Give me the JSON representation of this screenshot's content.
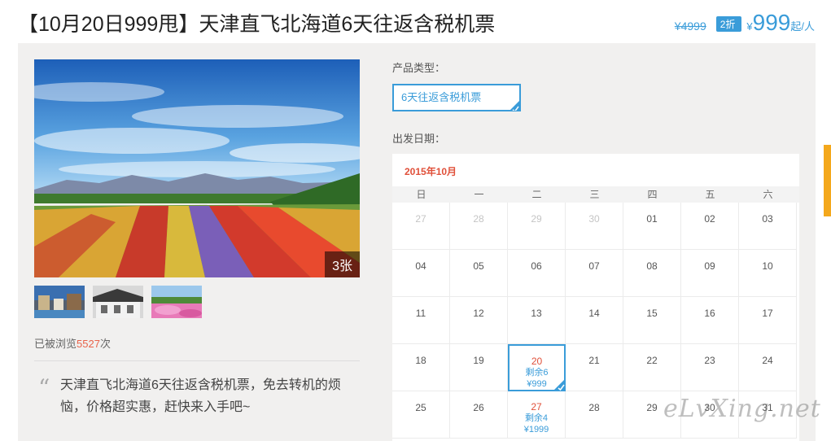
{
  "product": {
    "title": "【10月20日999甩】天津直飞北海道6天往返含税机票"
  },
  "pricing": {
    "original": "¥4999",
    "discount": "2折",
    "currency": "¥",
    "price": "999",
    "per_person": "起/人"
  },
  "gallery": {
    "photo_count": "3张"
  },
  "stats": {
    "views_prefix": "已被浏览",
    "views_count": "5527",
    "views_suffix": "次"
  },
  "intro": {
    "text": "天津直飞北海道6天往返含税机票，免去转机的烦恼，价格超实惠，赶快来入手吧~"
  },
  "options": {
    "product_type_label": "产品类型：",
    "product_type_value": "6天往返含税机票",
    "departure_label": "出发日期："
  },
  "calendar": {
    "month": "2015年10月",
    "weekdays": [
      "日",
      "一",
      "二",
      "三",
      "四",
      "五",
      "六"
    ],
    "weeks": [
      [
        {
          "d": "27",
          "o": true
        },
        {
          "d": "28",
          "o": true
        },
        {
          "d": "29",
          "o": true
        },
        {
          "d": "30",
          "o": true
        },
        {
          "d": "01"
        },
        {
          "d": "02"
        },
        {
          "d": "03"
        }
      ],
      [
        {
          "d": "04"
        },
        {
          "d": "05"
        },
        {
          "d": "06"
        },
        {
          "d": "07"
        },
        {
          "d": "08"
        },
        {
          "d": "09"
        },
        {
          "d": "10"
        }
      ],
      [
        {
          "d": "11"
        },
        {
          "d": "12"
        },
        {
          "d": "13"
        },
        {
          "d": "14"
        },
        {
          "d": "15"
        },
        {
          "d": "16"
        },
        {
          "d": "17"
        }
      ],
      [
        {
          "d": "18"
        },
        {
          "d": "19"
        },
        {
          "d": "20",
          "remain": "剩余6",
          "price": "¥999",
          "selected": true
        },
        {
          "d": "21"
        },
        {
          "d": "22"
        },
        {
          "d": "23"
        },
        {
          "d": "24"
        }
      ],
      [
        {
          "d": "25"
        },
        {
          "d": "26"
        },
        {
          "d": "27",
          "remain": "剩余4",
          "price": "¥1999"
        },
        {
          "d": "28"
        },
        {
          "d": "29"
        },
        {
          "d": "30"
        },
        {
          "d": "31"
        }
      ]
    ]
  },
  "watermark": "eLvXing.net",
  "colors": {
    "accent": "#3a9cd9",
    "highlight": "#e0503a",
    "panel_bg": "#f1f0ef"
  }
}
